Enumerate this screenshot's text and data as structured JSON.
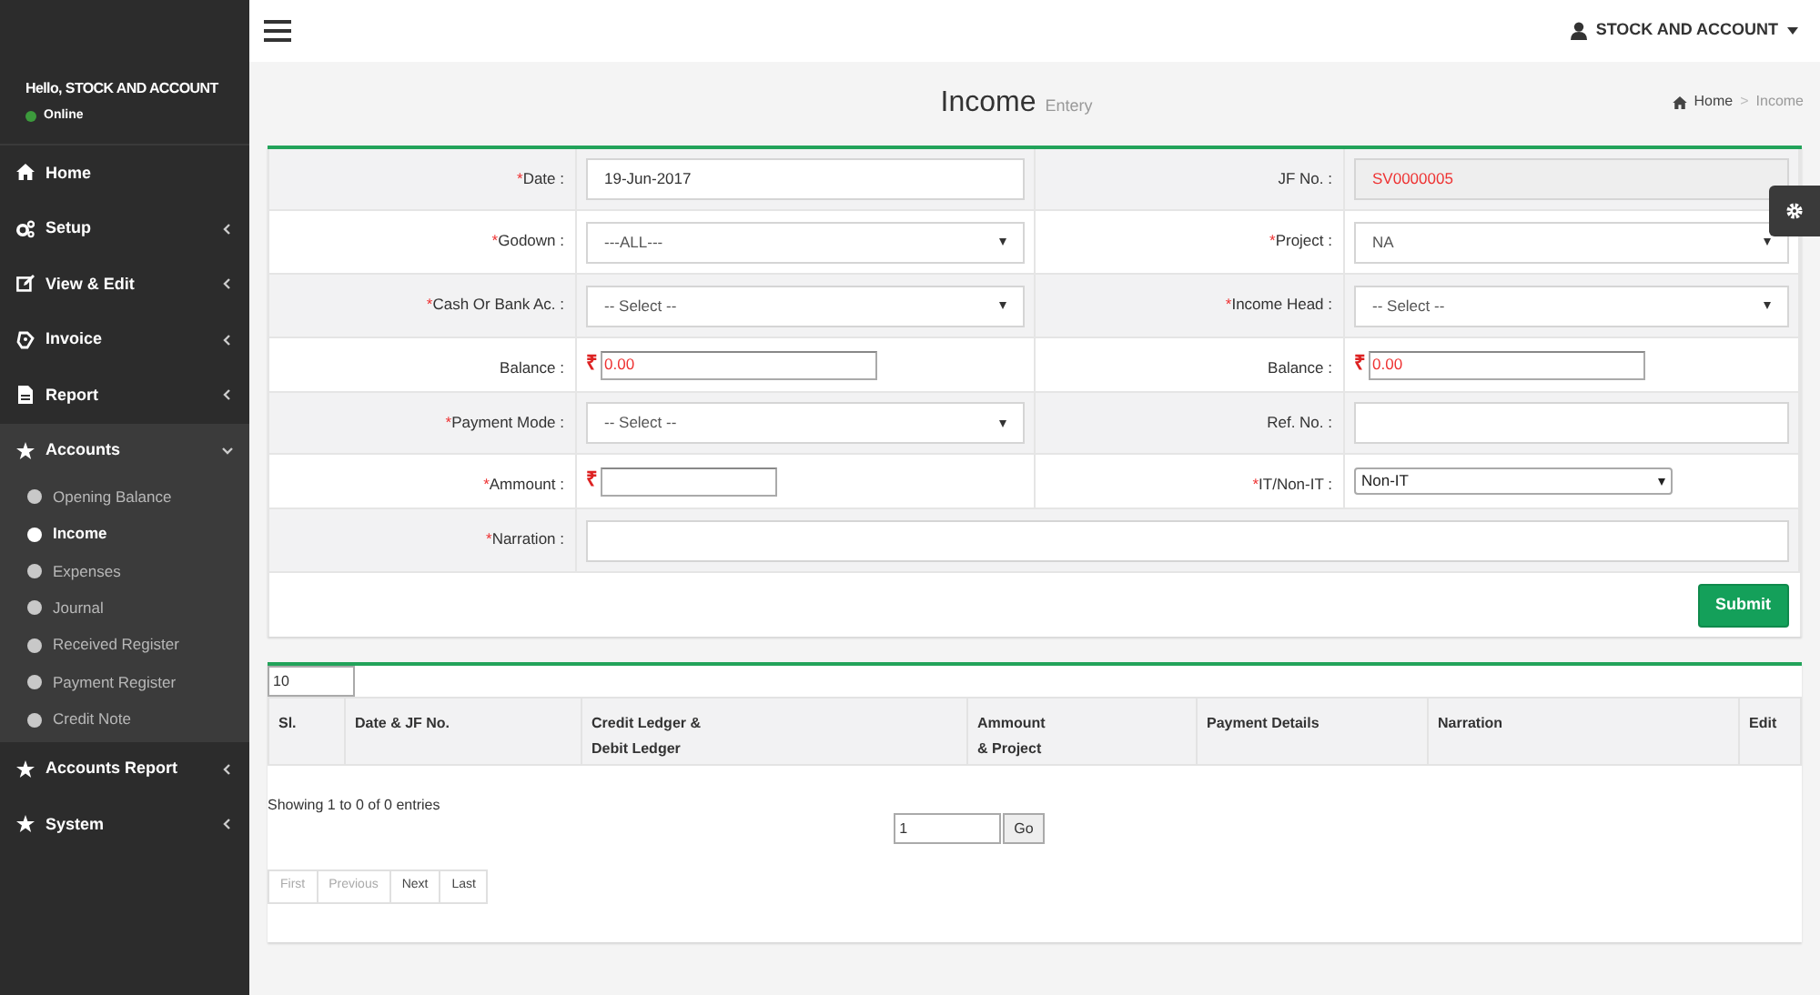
{
  "sidebar": {
    "greeting": "Hello, STOCK AND ACCOUNT",
    "status": "Online",
    "items": [
      {
        "label": "Home"
      },
      {
        "label": "Setup",
        "expanded": false
      },
      {
        "label": "View & Edit",
        "expanded": false
      },
      {
        "label": "Invoice",
        "expanded": false
      },
      {
        "label": "Report",
        "expanded": false
      },
      {
        "label": "Accounts",
        "expanded": true,
        "children": [
          {
            "label": "Opening Balance",
            "selected": false
          },
          {
            "label": "Income",
            "selected": true
          },
          {
            "label": "Expenses",
            "selected": false
          },
          {
            "label": "Journal",
            "selected": false
          },
          {
            "label": "Received Register",
            "selected": false
          },
          {
            "label": "Payment Register",
            "selected": false
          },
          {
            "label": "Credit Note",
            "selected": false
          }
        ]
      },
      {
        "label": "Accounts Report",
        "expanded": false
      },
      {
        "label": "System",
        "expanded": false
      }
    ]
  },
  "header": {
    "user": "STOCK AND ACCOUNT"
  },
  "page": {
    "title": "Income",
    "subtitle": "Entery",
    "breadcrumb": [
      "Home",
      "Income"
    ],
    "breadcrumb_separator": ">"
  },
  "form": {
    "rows": [
      {
        "cells": [
          {
            "label": "Date :",
            "required_mark": "*",
            "kind": "text",
            "value": "19-Jun-2017"
          },
          {
            "label": "JF No. :",
            "kind": "readonly",
            "value": "SV0000005"
          }
        ]
      },
      {
        "cells": [
          {
            "label": "Godown :",
            "required_mark": "*",
            "kind": "select",
            "value": "---ALL---"
          },
          {
            "label": "Project :",
            "required_mark": "*",
            "kind": "select",
            "value": "NA"
          }
        ]
      },
      {
        "cells": [
          {
            "label": "Cash Or Bank Ac. :",
            "required_mark": "*",
            "kind": "select",
            "value": "-- Select --"
          },
          {
            "label": "Income Head :",
            "required_mark": "*",
            "kind": "select",
            "value": "-- Select --"
          }
        ]
      },
      {
        "cells": [
          {
            "label": "Balance :",
            "kind": "currency",
            "currency_symbol": "₹",
            "value": "0.00"
          },
          {
            "label": "Balance :",
            "kind": "currency",
            "currency_symbol": "₹",
            "value": "0.00"
          }
        ]
      },
      {
        "cells": [
          {
            "label": "Payment Mode :",
            "required_mark": "*",
            "kind": "select",
            "value": "-- Select --"
          },
          {
            "label": "Ref. No. :",
            "kind": "text"
          }
        ]
      },
      {
        "cells": [
          {
            "label": "Ammount :",
            "required_mark": "*",
            "kind": "currency",
            "currency_symbol": "₹"
          },
          {
            "label": "IT/Non-IT :",
            "required_mark": "*",
            "kind": "small-select",
            "value": "Non-IT"
          }
        ]
      },
      {
        "cells": [
          {
            "label": "Narration :",
            "required_mark": "*",
            "kind": "text"
          }
        ]
      }
    ],
    "submit": "Submit"
  },
  "table": {
    "page_length": "10",
    "columns": [
      {
        "lines": [
          "Sl."
        ]
      },
      {
        "lines": [
          "Date & JF No."
        ]
      },
      {
        "lines": [
          "Credit Ledger &",
          "Debit Ledger"
        ]
      },
      {
        "lines": [
          "Ammount",
          "& Project"
        ]
      },
      {
        "lines": [
          "Payment Details"
        ]
      },
      {
        "lines": [
          "Narration"
        ]
      },
      {
        "lines": [
          "Edit"
        ]
      }
    ],
    "info": "Showing 1 to 0 of 0 entries",
    "page_input": "1",
    "go": "Go",
    "pagination": [
      {
        "label": "First",
        "disabled": true
      },
      {
        "label": "Previous",
        "disabled": true
      },
      {
        "label": "Next",
        "disabled": false
      },
      {
        "label": "Last",
        "disabled": false
      }
    ]
  }
}
